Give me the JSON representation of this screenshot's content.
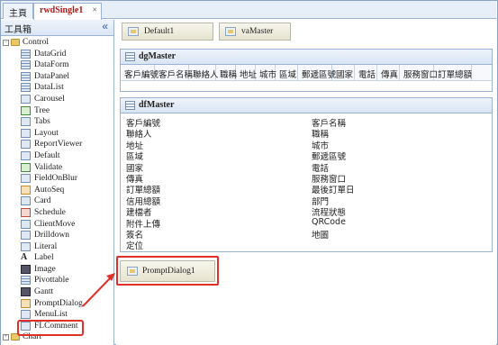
{
  "tabs": [
    {
      "label": "主頁"
    },
    {
      "label": "rwdSingle1",
      "close": "×"
    }
  ],
  "toolbox": {
    "title": "工具箱",
    "collapse_glyph": "«",
    "groups": [
      {
        "label": "Control",
        "toggle": "−",
        "items": [
          {
            "label": "DataGrid",
            "icon": "datagrid-icon"
          },
          {
            "label": "DataForm",
            "icon": "dataform-icon"
          },
          {
            "label": "DataPanel",
            "icon": "datapanel-icon"
          },
          {
            "label": "DataList",
            "icon": "datalist-icon"
          },
          {
            "label": "Carousel",
            "icon": "carousel-icon"
          },
          {
            "label": "Tree",
            "icon": "tree-icon"
          },
          {
            "label": "Tabs",
            "icon": "tabs-icon"
          },
          {
            "label": "Layout",
            "icon": "layout-icon"
          },
          {
            "label": "ReportViewer",
            "icon": "reportviewer-icon"
          },
          {
            "label": "Default",
            "icon": "default-icon"
          },
          {
            "label": "Validate",
            "icon": "validate-icon"
          },
          {
            "label": "FieldOnBlur",
            "icon": "fieldonblur-icon"
          },
          {
            "label": "AutoSeq",
            "icon": "autoseq-icon"
          },
          {
            "label": "Card",
            "icon": "card-icon"
          },
          {
            "label": "Schedule",
            "icon": "schedule-icon"
          },
          {
            "label": "ClientMove",
            "icon": "clientmove-icon"
          },
          {
            "label": "Drilldown",
            "icon": "drilldown-icon"
          },
          {
            "label": "Literal",
            "icon": "literal-icon"
          },
          {
            "label": "Label",
            "icon": "label-icon"
          },
          {
            "label": "Image",
            "icon": "image-icon"
          },
          {
            "label": "Pivottable",
            "icon": "pivottable-icon"
          },
          {
            "label": "Gantt",
            "icon": "gantt-icon"
          },
          {
            "label": "PromptDialog",
            "icon": "promptdialog-icon"
          },
          {
            "label": "MenuList",
            "icon": "menulist-icon"
          },
          {
            "label": "FLComment",
            "icon": "flcomment-icon"
          }
        ]
      },
      {
        "label": "Chart",
        "toggle": "+"
      }
    ]
  },
  "design": {
    "components": [
      {
        "label": "Default1"
      },
      {
        "label": "vaMaster"
      }
    ],
    "dgMaster": {
      "title": "dgMaster",
      "columns": [
        "客戶編號",
        "客戶名稱",
        "聯絡人",
        "職稱",
        "地址",
        "城市",
        "區域",
        "郵遞區號",
        "國家",
        "電話",
        "傳真",
        "服務窗口",
        "訂單總額"
      ]
    },
    "dfMaster": {
      "title": "dfMaster",
      "left_fields": [
        "客戶編號",
        "聯絡人",
        "地址",
        "區域",
        "國家",
        "傳真",
        "訂單總額",
        "信用總額",
        "建檔者",
        "附件上傳",
        "簽名",
        "定位"
      ],
      "right_fields": [
        "客戶名稱",
        "職稱",
        "城市",
        "郵遞區號",
        "電話",
        "服務窗口",
        "最後訂單日",
        "部門",
        "流程狀態",
        "QRCode",
        "地圖"
      ]
    },
    "dialog": {
      "label": "PromptDialog1"
    }
  },
  "colors": {
    "highlight": "#e0302a",
    "panel_border": "#9ab3d3",
    "active_tab_text": "#b01818"
  }
}
